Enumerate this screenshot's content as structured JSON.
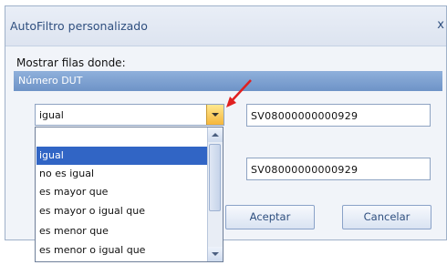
{
  "dialog": {
    "title": "AutoFiltro personalizado",
    "close_label": "x",
    "section_label": "Mostrar filas donde:",
    "group_header": "Número DUT"
  },
  "condition1": {
    "operator": "igual",
    "value": "SV08000000000929"
  },
  "condition2": {
    "value": "SV08000000000929"
  },
  "dropdown": {
    "options": [
      "",
      "igual",
      "no es igual",
      "es mayor que",
      "es mayor o igual que",
      "es menor que",
      "es menor o igual que"
    ],
    "selected_index": 1
  },
  "buttons": {
    "accept": "Aceptar",
    "cancel": "Cancelar"
  },
  "colors": {
    "annotation_arrow": "#e02020",
    "selection": "#3165c5",
    "header": "#7899cc"
  }
}
